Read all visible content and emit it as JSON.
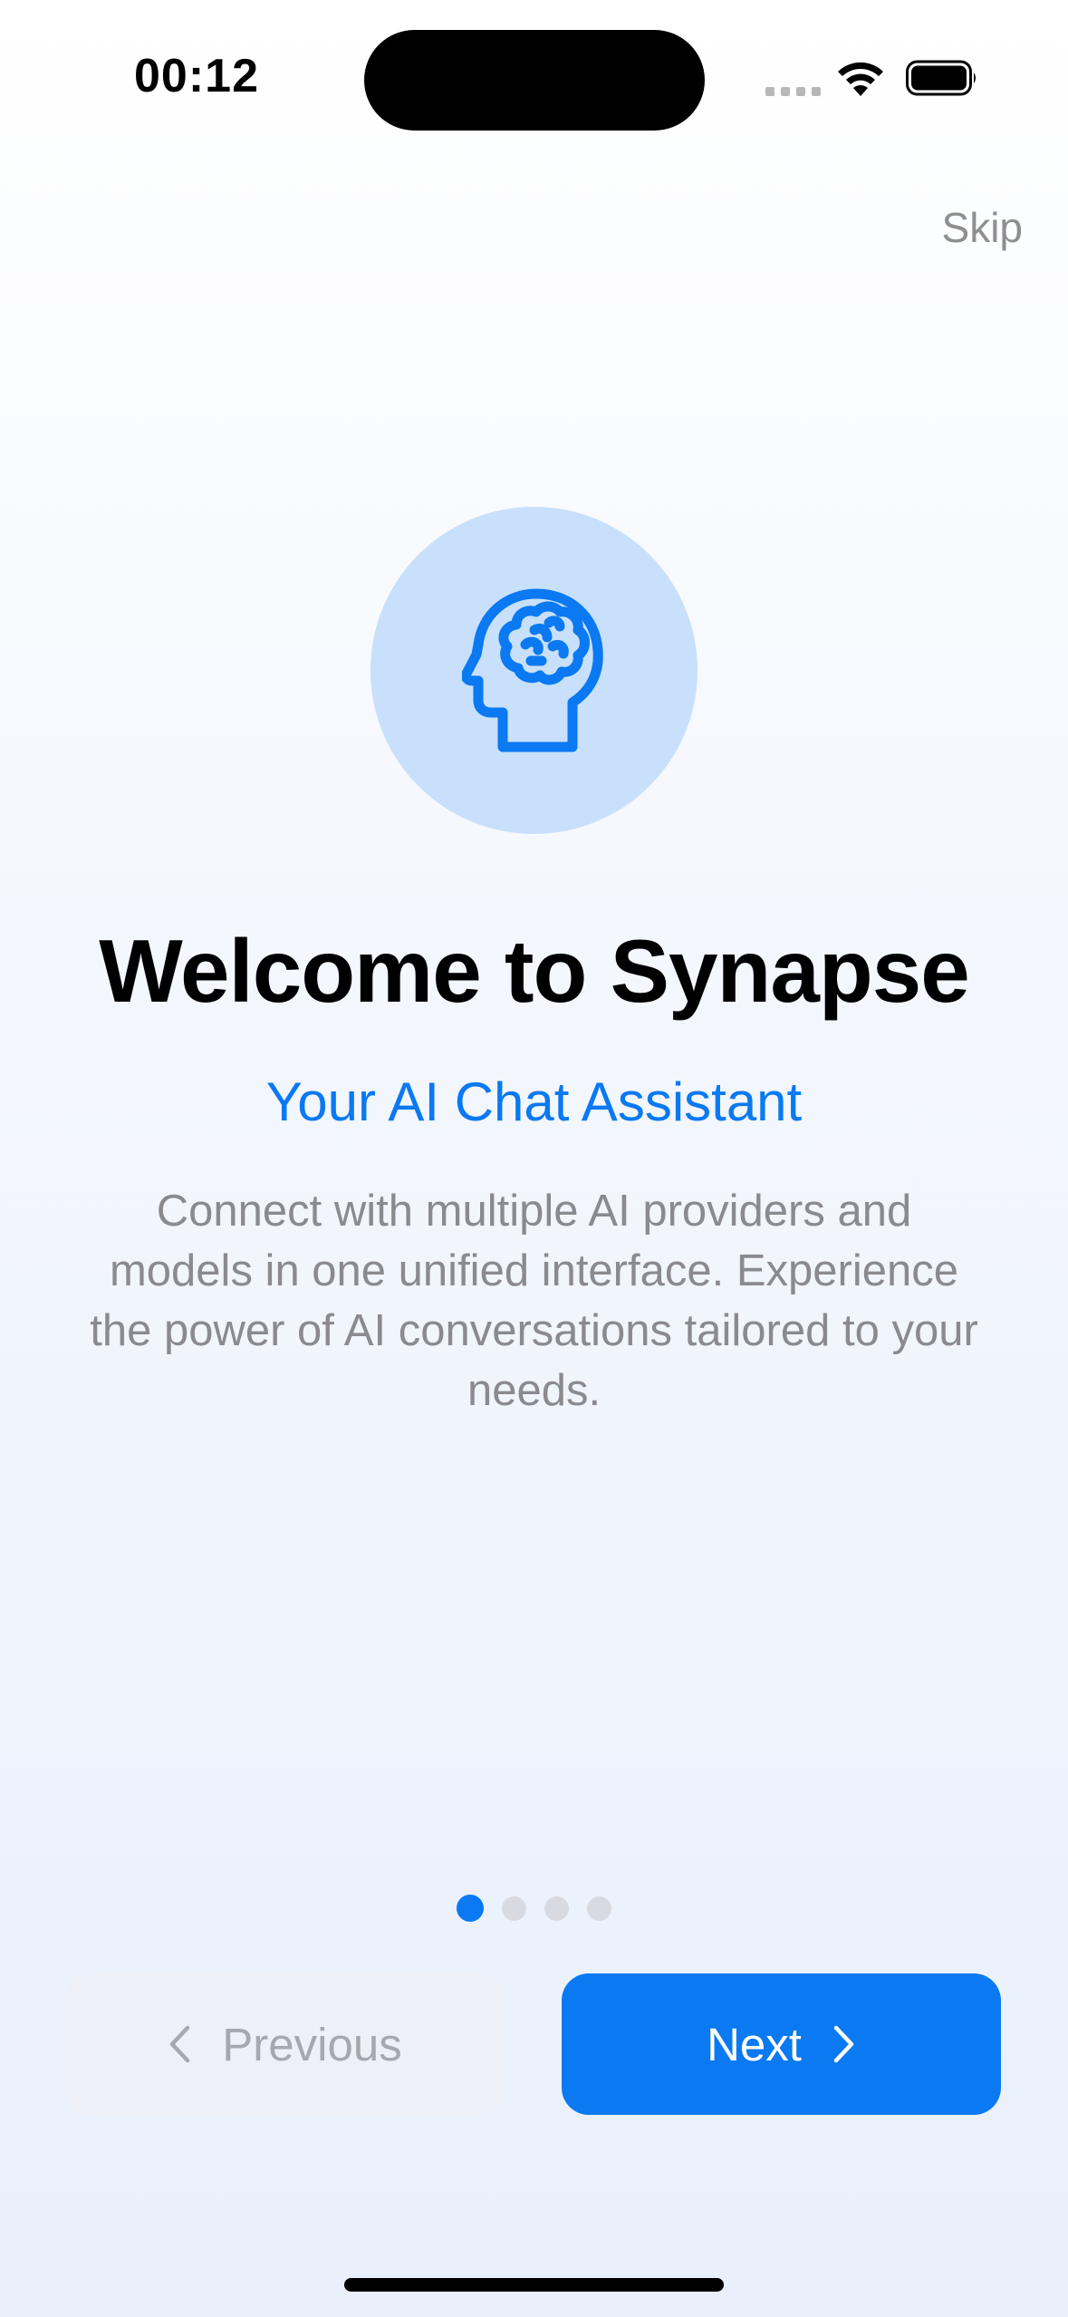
{
  "status_bar": {
    "time": "00:12"
  },
  "top_bar": {
    "skip_label": "Skip"
  },
  "hero": {
    "icon": "brain-head-icon"
  },
  "content": {
    "title": "Welcome to Synapse",
    "subtitle": "Your AI Chat Assistant",
    "description": "Connect with multiple AI providers and models in one unified interface. Experience the power of AI conversations tailored to your needs."
  },
  "pager": {
    "total": 4,
    "current": 1
  },
  "buttons": {
    "previous_label": "Previous",
    "next_label": "Next"
  },
  "colors": {
    "accent": "#0a79f2",
    "hero_circle": "#c8e0fb",
    "muted_text": "#8a8a8f",
    "disabled_button": "#edf1f7"
  }
}
